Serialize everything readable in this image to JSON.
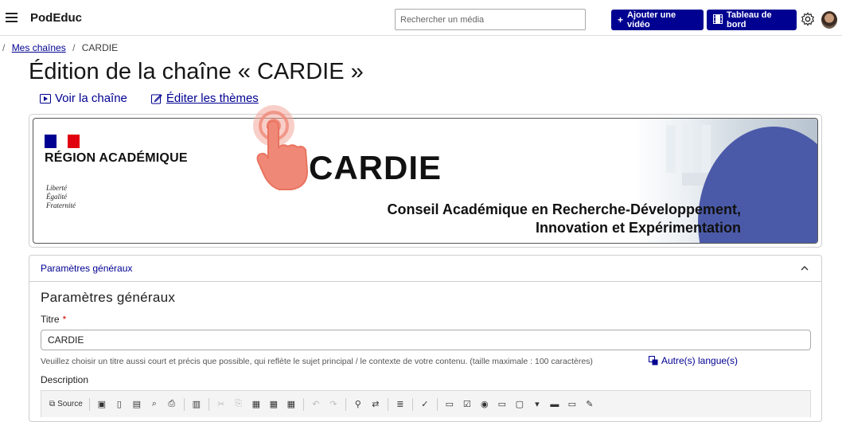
{
  "header": {
    "brand": "PodEduc",
    "search_placeholder": "Rechercher un média",
    "add_video_label": "Ajouter une vidéo",
    "dashboard_label": "Tableau de bord"
  },
  "breadcrumb": {
    "parent": "Mes chaînes",
    "separator": "/",
    "current": "CARDIE",
    "root_separator": "/"
  },
  "page": {
    "title": "Édition de la chaîne « CARDIE »",
    "view_channel": "Voir la chaîne",
    "edit_themes": "Éditer les thèmes"
  },
  "banner": {
    "region": "RÉGION ACADÉMIQUE",
    "motto": [
      "Liberté",
      "Égalité",
      "Fraternité"
    ],
    "name": "CARDIE",
    "subtitle_line1": "Conseil Académique en Recherche-Développement,",
    "subtitle_line2": "Innovation et Expérimentation",
    "colors": {
      "flag_blue": "#000091",
      "flag_red": "#e1000f",
      "swoosh": "#4b5aa8"
    }
  },
  "form": {
    "accordion_title": "Paramètres généraux",
    "section_title": "Paramètres généraux",
    "title_label": "Titre",
    "required_mark": "*",
    "title_value": "CARDIE",
    "title_help": "Veuillez choisir un titre aussi court et précis que possible, qui reflète le sujet principal / le contexte de votre contenu. (taille maximale : 100 caractères)",
    "other_languages": "Autre(s) langue(s)",
    "description_label": "Description",
    "toolbar_source": "Source"
  },
  "colors": {
    "accent": "#000091",
    "required": "#ce0500"
  }
}
